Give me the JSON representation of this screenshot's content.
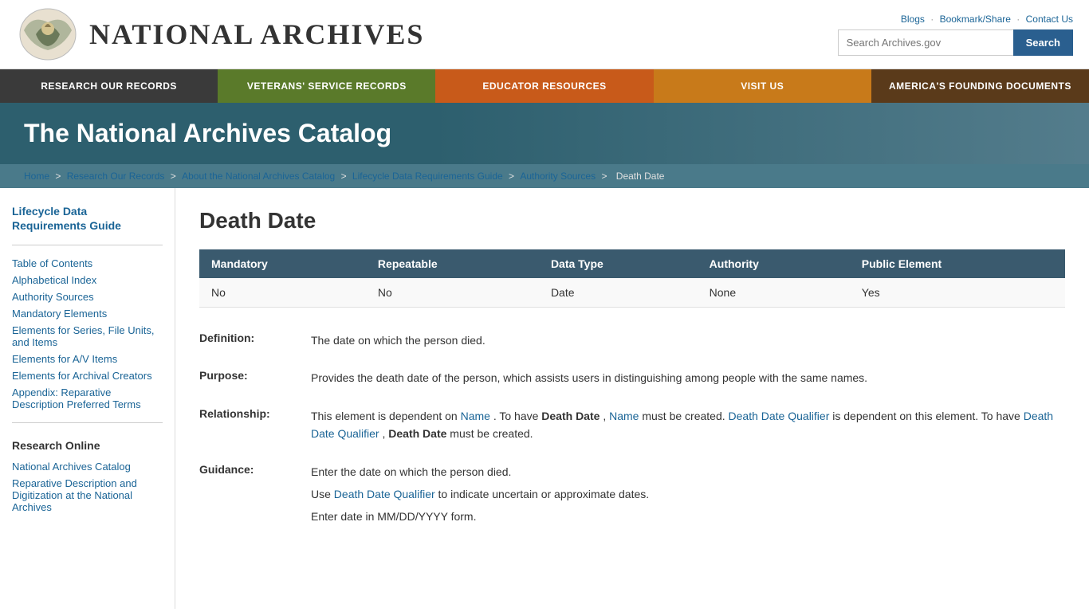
{
  "header": {
    "site_title": "NATIONAL ARCHIVES",
    "top_links": [
      "Blogs",
      "Bookmark/Share",
      "Contact Us"
    ],
    "search_placeholder": "Search Archives.gov",
    "search_button": "Search"
  },
  "nav": {
    "items": [
      {
        "label": "RESEARCH OUR RECORDS",
        "color_class": "nav-item-1"
      },
      {
        "label": "VETERANS' SERVICE RECORDS",
        "color_class": "nav-item-2"
      },
      {
        "label": "EDUCATOR RESOURCES",
        "color_class": "nav-item-3"
      },
      {
        "label": "VISIT US",
        "color_class": "nav-item-4"
      },
      {
        "label": "AMERICA'S FOUNDING DOCUMENTS",
        "color_class": "nav-item-5"
      }
    ]
  },
  "banner": {
    "title": "The National Archives Catalog"
  },
  "breadcrumb": {
    "items": [
      "Home",
      "Research Our Records",
      "About the National Archives Catalog",
      "Lifecycle Data Requirements Guide",
      "Authority Sources",
      "Death Date"
    ]
  },
  "sidebar": {
    "main_link": "Lifecycle Data Requirements Guide",
    "nav_items": [
      "Table of Contents",
      "Alphabetical Index",
      "Authority Sources",
      "Mandatory Elements",
      "Elements for Series, File Units, and Items",
      "Elements for A/V Items",
      "Elements for Archival Creators",
      "Appendix: Reparative Description Preferred Terms"
    ],
    "research_section": "Research Online",
    "research_items": [
      "National Archives Catalog",
      "Reparative Description and Digitization at the National Archives"
    ]
  },
  "content": {
    "page_title": "Death Date",
    "table": {
      "headers": [
        "Mandatory",
        "Repeatable",
        "Data Type",
        "Authority",
        "Public Element"
      ],
      "row": [
        "No",
        "No",
        "Date",
        "None",
        "Yes"
      ]
    },
    "definition": {
      "label": "Definition:",
      "text": "The date on which the person died."
    },
    "purpose": {
      "label": "Purpose:",
      "text": "Provides the death date of the person, which assists users in distinguishing among people with the same names."
    },
    "relationship": {
      "label": "Relationship:",
      "intro": "This element is dependent on",
      "name_link1": "Name",
      "mid1": ". To have",
      "bold1": "Death Date",
      "comma": ",",
      "name_link2": "Name",
      "mid2": "must be created.",
      "ddq_link": "Death Date Qualifier",
      "mid3": "is dependent on this element. To have",
      "ddq_link2": "Death Date Qualifier",
      "bold2": "Death Date",
      "end": "must be created."
    },
    "guidance": {
      "label": "Guidance:",
      "lines": [
        "Enter the date on which the person died.",
        "Use Death Date Qualifier to indicate uncertain or approximate dates.",
        "Enter date in MM/DD/YYYY form."
      ],
      "ddq_link": "Death Date Qualifier"
    }
  }
}
